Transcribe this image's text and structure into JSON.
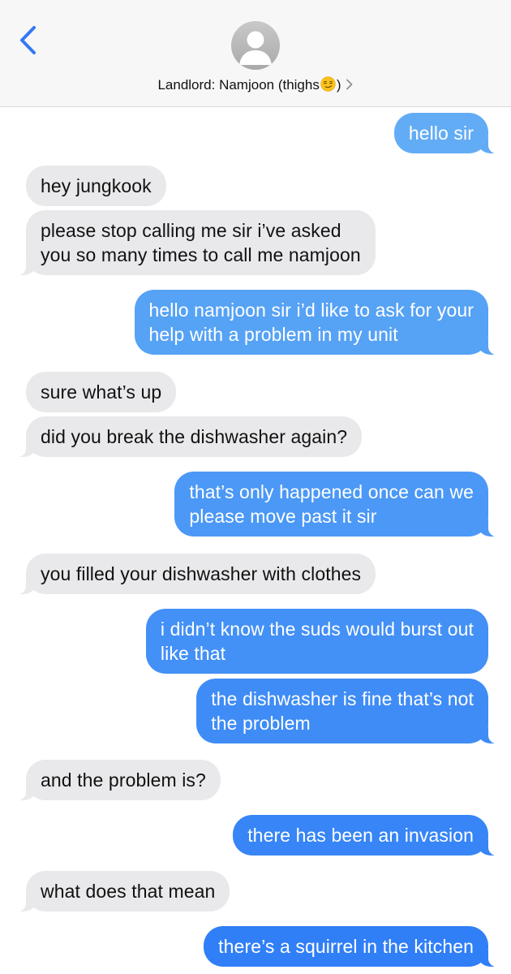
{
  "header": {
    "back_icon": "chevron-left-icon",
    "avatar_icon": "person-silhouette-icon",
    "contact_name_prefix": "Landlord: Namjoon (thighs",
    "contact_name_suffix": ")",
    "emoji": "smirking-face-emoji",
    "chevron": "chevron-right-icon",
    "accent_color": "#3478f6"
  },
  "colors": {
    "received_bubble": "#e9e9eb",
    "sent_bubble_top": "#6ab4f5",
    "sent_bubble_bottom": "#2f7df6"
  },
  "messages": [
    {
      "direction": "sent",
      "text": "hello sir"
    },
    {
      "direction": "received",
      "text": "hey jungkook"
    },
    {
      "direction": "received",
      "text": "please stop calling me sir i’ve asked\nyou so many times to call me namjoon"
    },
    {
      "direction": "sent",
      "text": "hello namjoon sir i’d like to ask for your\nhelp with a problem in my unit"
    },
    {
      "direction": "received",
      "text": "sure what’s up"
    },
    {
      "direction": "received",
      "text": "did you break the dishwasher again?"
    },
    {
      "direction": "sent",
      "text": "that’s only happened once can we\nplease move past it sir"
    },
    {
      "direction": "received",
      "text": "you filled your dishwasher with clothes"
    },
    {
      "direction": "sent",
      "text": "i didn’t know the suds would burst out\nlike that"
    },
    {
      "direction": "sent",
      "text": "the dishwasher is fine that’s not\nthe problem"
    },
    {
      "direction": "received",
      "text": "and the problem is?"
    },
    {
      "direction": "sent",
      "text": "there has been an invasion"
    },
    {
      "direction": "received",
      "text": "what does that mean"
    },
    {
      "direction": "sent",
      "text": "there’s a squirrel in the kitchen"
    }
  ]
}
